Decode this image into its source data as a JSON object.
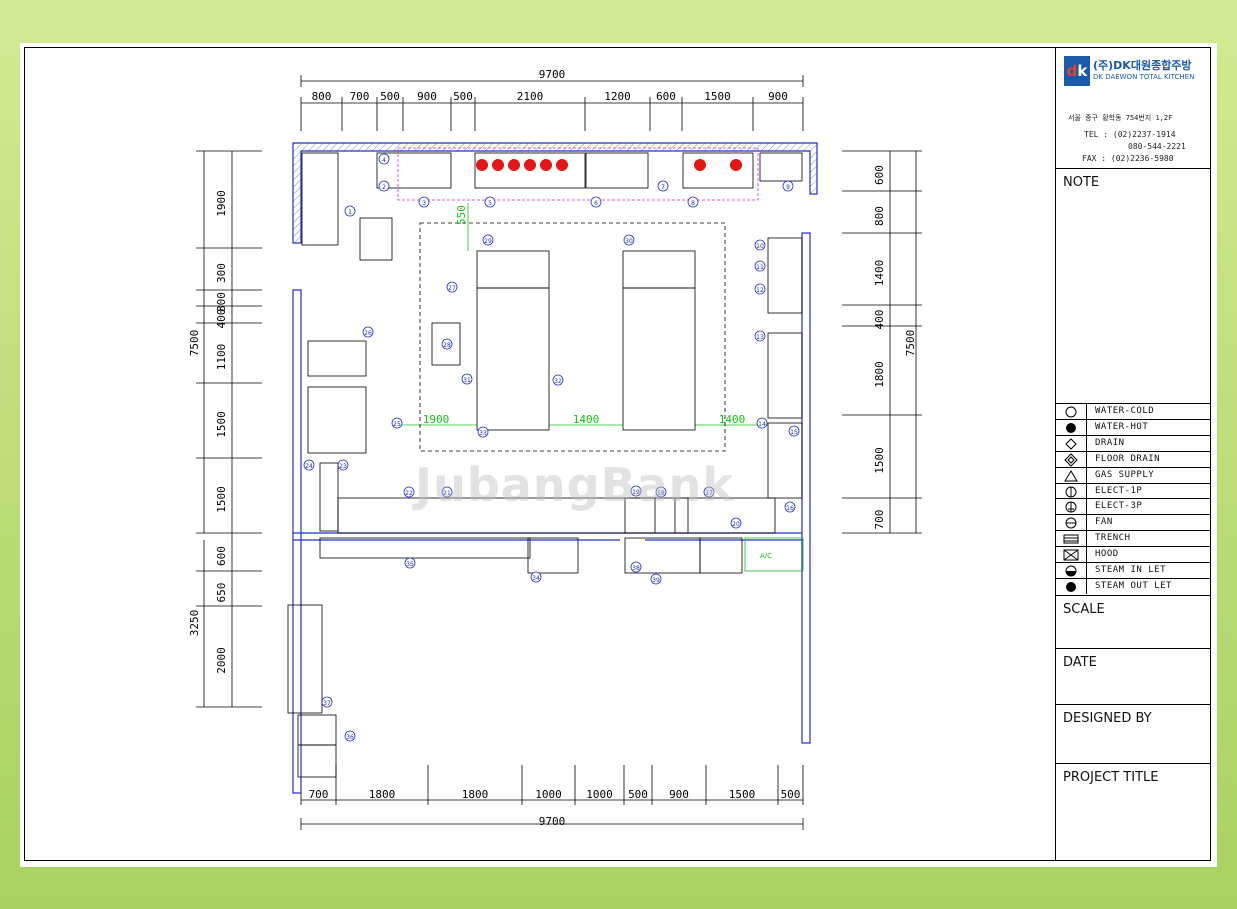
{
  "drawing": {
    "dim_top": [
      "800",
      "700",
      "500",
      "900",
      "500",
      "2100",
      "1200",
      "600",
      "1500",
      "900"
    ],
    "dim_top_total": "9700",
    "dim_bottom": [
      "700",
      "1800",
      "1800",
      "1000",
      "1000",
      "500",
      "900",
      "1500",
      "500"
    ],
    "dim_bottom_total": "9700",
    "dim_left": [
      "1900",
      "300",
      "800",
      "400",
      "1100",
      "1500",
      "1500",
      "600",
      "650",
      "2000"
    ],
    "dim_left_totals": [
      "7500",
      "3250"
    ],
    "dim_right": [
      "600",
      "800",
      "1400",
      "400",
      "1800",
      "1500",
      "700"
    ],
    "dim_right_total": "7500",
    "inner_dims": [
      "1900",
      "1400",
      "1400",
      "550"
    ],
    "ac_label": "A/C",
    "callouts": [
      "1",
      "2",
      "3",
      "4",
      "5",
      "6",
      "7",
      "8",
      "9",
      "10",
      "11",
      "12",
      "13",
      "14",
      "15",
      "16",
      "17",
      "18",
      "19",
      "20",
      "21",
      "22",
      "23",
      "24",
      "25",
      "26",
      "27",
      "28",
      "29",
      "30",
      "31",
      "32",
      "33",
      "34",
      "35",
      "36",
      "37",
      "38",
      "39"
    ],
    "watermark": "JubangBank"
  },
  "title_block": {
    "logo_mark": "DK",
    "company_ko": "(주)DK대원종합주방",
    "company_en": "DK DAEWON TOTAL KITCHEN",
    "address": "서울 중구 황학동 754번지 1,2F",
    "tel": "TEL : (02)2237-1914",
    "tel2": "080-544-2221",
    "fax": "FAX : (02)2236-5980",
    "sections": {
      "note": "NOTE",
      "scale": "SCALE",
      "date": "DATE",
      "designed_by": "DESIGNED BY",
      "project_title": "PROJECT TITLE"
    }
  },
  "legend": [
    {
      "icon": "water-cold-icon",
      "label": "WATER-COLD"
    },
    {
      "icon": "water-hot-icon",
      "label": "WATER-HOT"
    },
    {
      "icon": "drain-icon",
      "label": "DRAIN"
    },
    {
      "icon": "floor-drain-icon",
      "label": "FLOOR DRAIN"
    },
    {
      "icon": "gas-supply-icon",
      "label": "GAS SUPPLY"
    },
    {
      "icon": "elect-1p-icon",
      "label": "ELECT-1P"
    },
    {
      "icon": "elect-3p-icon",
      "label": "ELECT-3P"
    },
    {
      "icon": "fan-icon",
      "label": "FAN"
    },
    {
      "icon": "trench-icon",
      "label": "TRENCH"
    },
    {
      "icon": "hood-icon",
      "label": "HOOD"
    },
    {
      "icon": "steam-inlet-icon",
      "label": "STEAM IN LET"
    },
    {
      "icon": "steam-outlet-icon",
      "label": "STEAM OUT LET"
    }
  ],
  "colors": {
    "wall": "#2030c8",
    "fixture": "#000000",
    "gas": "#e01818",
    "hood": "#e020e0",
    "dimension_green": "#18c018"
  }
}
